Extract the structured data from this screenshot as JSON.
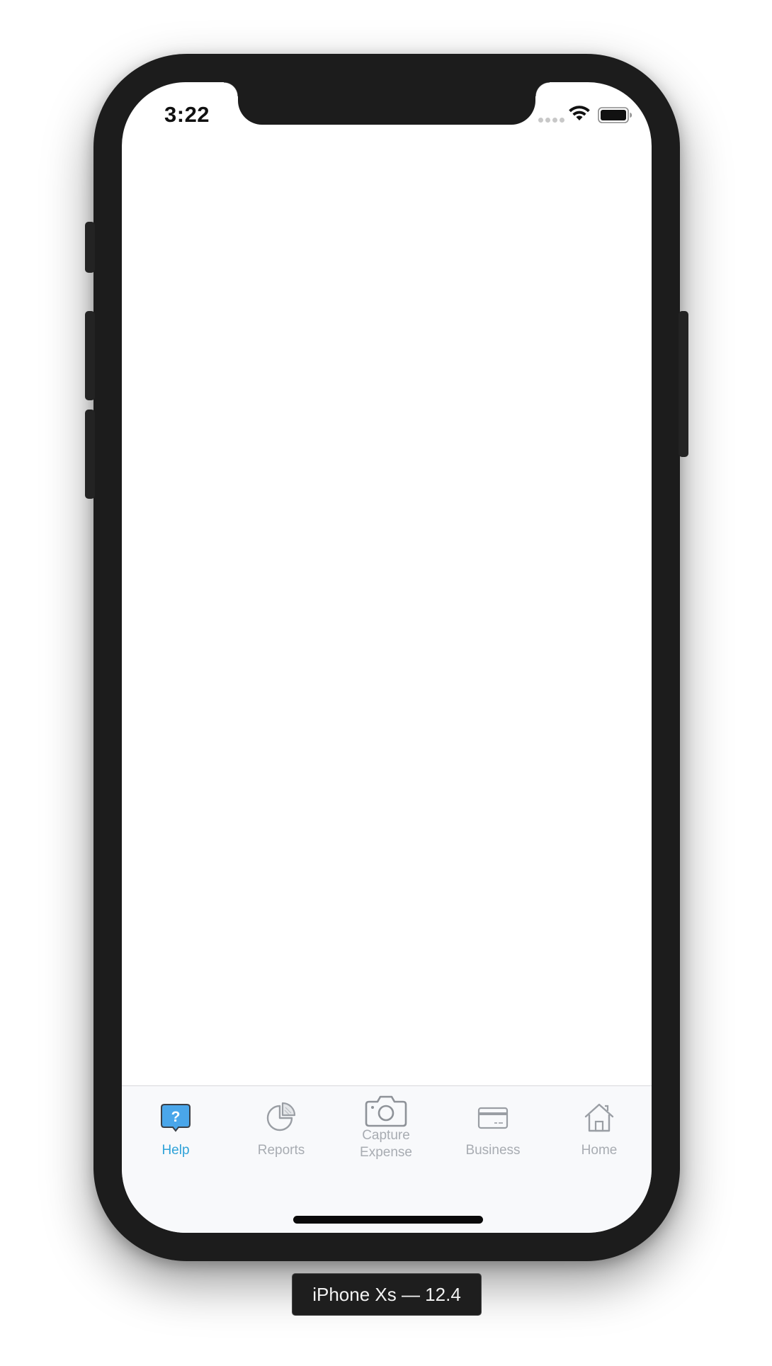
{
  "status_bar": {
    "time": "3:22",
    "icons": [
      "signal-dots-icon",
      "wifi-icon",
      "battery-icon"
    ]
  },
  "tab_bar": {
    "active_color": "#2fa2d8",
    "inactive_color": "#a8acb2",
    "items": [
      {
        "label": "Help",
        "icon": "help-bubble-icon",
        "active": true
      },
      {
        "label": "Reports",
        "icon": "pie-chart-icon",
        "active": false
      },
      {
        "label": "Capture Expense",
        "label_line1": "Capture",
        "label_line2": "Expense",
        "icon": "camera-icon",
        "active": false
      },
      {
        "label": "Business",
        "icon": "credit-card-icon",
        "active": false
      },
      {
        "label": "Home",
        "icon": "house-icon",
        "active": false
      }
    ]
  },
  "simulator": {
    "device_label": "iPhone Xs — 12.4"
  },
  "colors": {
    "device_frame": "#1c1c1c",
    "help_icon_fill": "#4aa6ea"
  }
}
